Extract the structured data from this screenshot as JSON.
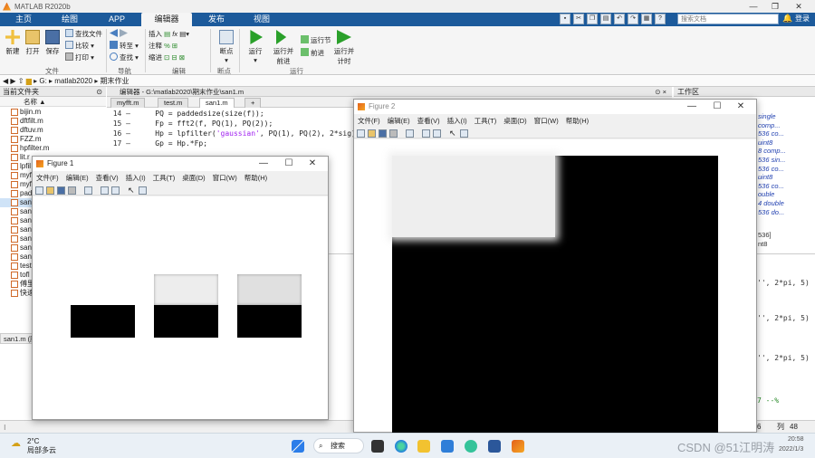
{
  "window": {
    "title": "MATLAB R2020b"
  },
  "tabs": [
    "主页",
    "绘图",
    "APP",
    "编辑器",
    "发布",
    "视图"
  ],
  "toolbar": {
    "search_placeholder": "搜索文档",
    "login": "登录",
    "file_group": {
      "new": "新建",
      "open": "打开",
      "save": "保存",
      "find_file": "查找文件",
      "compare": "比较",
      "print": "打印",
      "label": "文件"
    },
    "nav_group": {
      "goto": "转至",
      "find": "查找",
      "label": "导航"
    },
    "edit_group": {
      "insert": "插入",
      "comment": "注释",
      "indent": "缩进",
      "label": "编辑"
    },
    "breakpoints_group": {
      "breakpoints": "断点",
      "label": "断点"
    },
    "run_group": {
      "run": "运行",
      "run_advance": "运行并前进",
      "run_section": "运行节",
      "advance": "前进",
      "run_time": "运行并计时",
      "label": "运行"
    }
  },
  "address": {
    "path": [
      "G:",
      "matlab2020",
      "期末作业"
    ]
  },
  "current_folder": {
    "title": "当前文件夹",
    "column": "名称 ▲",
    "files": [
      "bijin.m",
      "dftfilt.m",
      "dftuv.m",
      "FZZ.m",
      "hpfilter.m",
      "lit.r",
      "lpfil",
      "myf",
      "myf",
      "pad",
      "san",
      "san",
      "san",
      "san",
      "san",
      "san",
      "san",
      "test",
      "tofl",
      "傅里",
      "快速"
    ],
    "selected_index": 10,
    "details": "san1.m (脚"
  },
  "editor": {
    "title": "编辑器 - G:\\matlab2020\\期末作业\\san1.m",
    "tabs": [
      "myfft.m",
      "test.m",
      "san1.m",
      "+"
    ],
    "active_tab": 2,
    "lines": [
      {
        "n": "14 —",
        "pre": "    PQ = paddedsize(size(f));",
        "str": "",
        "post": ""
      },
      {
        "n": "15 —",
        "pre": "    Fp = fft2(f, PQ(1), PQ(2));",
        "str": "",
        "post": ""
      },
      {
        "n": "16 —",
        "pre": "    Hp = lpfilter(",
        "str": "'gaussian'",
        "post": ", PQ(1), PQ(2), 2*sig);"
      },
      {
        "n": "17 —",
        "pre": "    Gp = Hp.*Fp;",
        "str": "",
        "post": ""
      }
    ]
  },
  "workspace": {
    "title": "工作区",
    "items": [
      "single",
      "comp...",
      "536 co...",
      "uint8",
      "8 comp...",
      "536 sin...",
      "536 co...",
      "uint8",
      "536 co...",
      "ouble",
      "4 double",
      "536 do..."
    ],
    "extra": [
      "536]",
      "nt8"
    ]
  },
  "command_window": {
    "lines": [
      "'', 2*pi, 5)",
      "'', 2*pi, 5)",
      "'', 2*pi, 5)",
      "7 --%"
    ]
  },
  "status": {
    "line_label": "6",
    "col_label": "列",
    "col_value": "48"
  },
  "figure1": {
    "title": "Figure 1",
    "menu": [
      "文件(F)",
      "编辑(E)",
      "查看(V)",
      "插入(I)",
      "工具(T)",
      "桌面(D)",
      "窗口(W)",
      "帮助(H)"
    ],
    "subplot_top_gray": [
      1.0,
      0.93,
      0.88
    ]
  },
  "figure2": {
    "title": "Figure 2",
    "menu": [
      "文件(F)",
      "编辑(E)",
      "查看(V)",
      "插入(I)",
      "工具(T)",
      "桌面(D)",
      "窗口(W)",
      "帮助(H)"
    ]
  },
  "taskbar": {
    "weather_temp": "2°C",
    "weather_desc": "局部多云",
    "search_label": "搜索",
    "clock_time": "20:58",
    "clock_date": "2022/1/3",
    "watermark": "CSDN @51江明涛"
  },
  "colors": {
    "ribbon_blue": "#1c5a9b",
    "accent_orange": "#e3611b"
  }
}
